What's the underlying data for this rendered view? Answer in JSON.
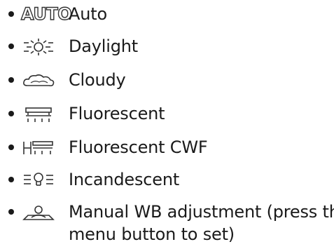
{
  "wb_list": {
    "items": [
      {
        "id": "auto",
        "icon": "wb-auto-icon",
        "icon_text": "AUTO",
        "label": "Auto"
      },
      {
        "id": "daylight",
        "icon": "wb-daylight-icon",
        "label": "Daylight"
      },
      {
        "id": "cloudy",
        "icon": "wb-cloudy-icon",
        "label": "Cloudy"
      },
      {
        "id": "fluorescent",
        "icon": "wb-fluorescent-icon",
        "label": "Fluorescent"
      },
      {
        "id": "fluorescent-cwf",
        "icon": "wb-fluorescent-cwf-icon",
        "label": "Fluorescent CWF"
      },
      {
        "id": "incandescent",
        "icon": "wb-incandescent-icon",
        "label": "Incandescent"
      },
      {
        "id": "manual",
        "icon": "wb-manual-icon",
        "label_line1": "Manual WB adjustment (press the",
        "label_line2": "menu button to set)"
      }
    ]
  }
}
